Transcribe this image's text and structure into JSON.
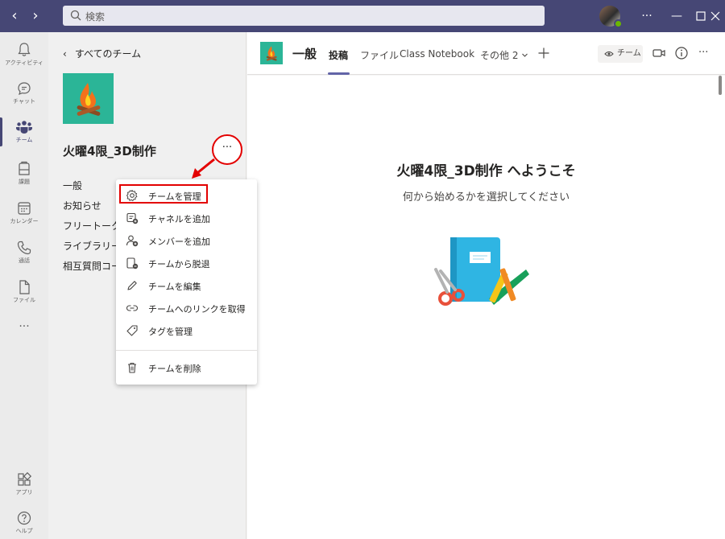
{
  "titlebar": {
    "search_placeholder": "検索",
    "back_arrow": "‹",
    "forward_arrow": "›"
  },
  "rail": {
    "items": [
      {
        "label": "アクティビティ",
        "icon": "bell-icon"
      },
      {
        "label": "チャット",
        "icon": "chat-icon"
      },
      {
        "label": "チーム",
        "icon": "teams-icon",
        "active": true
      },
      {
        "label": "課題",
        "icon": "assignments-icon"
      },
      {
        "label": "カレンダー",
        "icon": "calendar-icon"
      },
      {
        "label": "通話",
        "icon": "phone-icon"
      },
      {
        "label": "ファイル",
        "icon": "file-icon"
      }
    ],
    "more": "···",
    "apps_label": "アプリ",
    "help_label": "ヘルプ"
  },
  "team_panel": {
    "back_label": "すべてのチーム",
    "team_name": "火曜4限_3D制作",
    "channels": [
      "一般",
      "お知らせ",
      "フリートーク",
      "ライブラリー",
      "相互質問コー"
    ],
    "more_button": "···"
  },
  "header": {
    "channel_name": "一般",
    "tabs": [
      "投稿",
      "ファイル",
      "Class Notebook",
      "その他 2"
    ],
    "team_button": "チーム"
  },
  "content": {
    "welcome_title": "火曜4限_3D制作 へようこそ",
    "welcome_subtitle": "何から始めるかを選択してください"
  },
  "menu": {
    "items": [
      {
        "label": "チームを管理",
        "icon": "gear-icon"
      },
      {
        "label": "チャネルを追加",
        "icon": "add-channel-icon"
      },
      {
        "label": "メンバーを追加",
        "icon": "add-member-icon"
      },
      {
        "label": "チームから脱退",
        "icon": "leave-team-icon"
      },
      {
        "label": "チームを編集",
        "icon": "pencil-icon"
      },
      {
        "label": "チームへのリンクを取得",
        "icon": "link-icon"
      },
      {
        "label": "タグを管理",
        "icon": "tag-icon"
      },
      {
        "label": "チームを削除",
        "icon": "trash-icon"
      }
    ]
  },
  "colors": {
    "titlebar": "#464775",
    "accent": "#6264a7",
    "team_tile": "#2bb597",
    "annotation": "#e30000"
  }
}
